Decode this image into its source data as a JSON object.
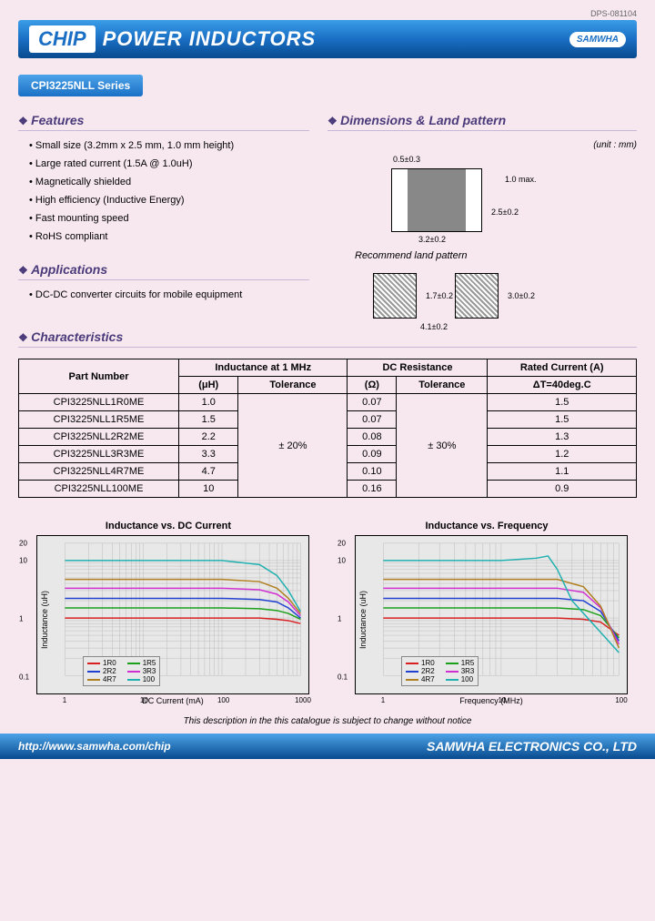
{
  "doc_id": "DPS-081104",
  "banner": {
    "chip": "CHIP",
    "title": "POWER INDUCTORS",
    "logo": "SAMWHA"
  },
  "series_badge": "CPI3225NLL Series",
  "features": {
    "title": "Features",
    "items": [
      "Small size (3.2mm x 2.5 mm, 1.0 mm height)",
      "Large rated current (1.5A @ 1.0uH)",
      "Magnetically shielded",
      "High efficiency (Inductive Energy)",
      "Fast mounting speed",
      "RoHS compliant"
    ]
  },
  "applications": {
    "title": "Applications",
    "items": [
      "DC-DC converter circuits for mobile equipment"
    ]
  },
  "dimensions": {
    "title": "Dimensions & Land pattern",
    "unit": "(unit : mm)",
    "dim_top": "0.5±0.3",
    "dim_height": "1.0 max.",
    "dim_width": "3.2±0.2",
    "dim_depth": "2.5±0.2",
    "land_title": "Recommend land pattern",
    "land_gap": "1.7±0.2",
    "land_h": "3.0±0.2",
    "land_w": "4.1±0.2"
  },
  "characteristics": {
    "title": "Characteristics",
    "headers": {
      "part": "Part Number",
      "ind": "Inductance at 1 MHz",
      "ind_uh": "(μH)",
      "ind_tol": "Tolerance",
      "dcr": "DC Resistance",
      "dcr_ohm": "(Ω)",
      "dcr_tol": "Tolerance",
      "rated": "Rated Current (A)",
      "rated_sub": "ΔT=40deg.C"
    },
    "ind_tol_val": "± 20%",
    "dcr_tol_val": "± 30%",
    "rows": [
      {
        "pn": "CPI3225NLL1R0ME",
        "uh": "1.0",
        "ohm": "0.07",
        "rated": "1.5"
      },
      {
        "pn": "CPI3225NLL1R5ME",
        "uh": "1.5",
        "ohm": "0.07",
        "rated": "1.5"
      },
      {
        "pn": "CPI3225NLL2R2ME",
        "uh": "2.2",
        "ohm": "0.08",
        "rated": "1.3"
      },
      {
        "pn": "CPI3225NLL3R3ME",
        "uh": "3.3",
        "ohm": "0.09",
        "rated": "1.2"
      },
      {
        "pn": "CPI3225NLL4R7ME",
        "uh": "4.7",
        "ohm": "0.10",
        "rated": "1.1"
      },
      {
        "pn": "CPI3225NLL100ME",
        "uh": "10",
        "ohm": "0.16",
        "rated": "0.9"
      }
    ]
  },
  "chart_data": [
    {
      "type": "line",
      "title": "Inductance vs. DC Current",
      "xlabel": "DC Current (mA)",
      "ylabel": "Inductance (uH)",
      "x_scale": "log",
      "y_scale": "log",
      "xlim": [
        1,
        1000
      ],
      "ylim": [
        0.1,
        20
      ],
      "x_ticks": [
        1,
        10,
        100,
        1000
      ],
      "y_ticks": [
        0.1,
        1,
        10,
        20
      ],
      "legend": [
        "1R0",
        "1R5",
        "2R2",
        "3R3",
        "4R7",
        "100"
      ],
      "colors": {
        "1R0": "#d92020",
        "1R5": "#1aa01a",
        "2R2": "#2040d0",
        "3R3": "#d030d0",
        "4R7": "#b08020",
        "100": "#20b0b0"
      },
      "series": [
        {
          "name": "1R0",
          "x": [
            1,
            100,
            300,
            500,
            700,
            1000
          ],
          "y": [
            1.0,
            1.0,
            1.0,
            0.95,
            0.9,
            0.8
          ]
        },
        {
          "name": "1R5",
          "x": [
            1,
            100,
            300,
            500,
            700,
            1000
          ],
          "y": [
            1.5,
            1.5,
            1.45,
            1.35,
            1.2,
            0.95
          ]
        },
        {
          "name": "2R2",
          "x": [
            1,
            100,
            300,
            500,
            700,
            1000
          ],
          "y": [
            2.2,
            2.2,
            2.1,
            1.9,
            1.5,
            1.0
          ]
        },
        {
          "name": "3R3",
          "x": [
            1,
            100,
            300,
            500,
            700,
            1000
          ],
          "y": [
            3.3,
            3.3,
            3.1,
            2.6,
            1.9,
            1.1
          ]
        },
        {
          "name": "4R7",
          "x": [
            1,
            100,
            300,
            500,
            700,
            1000
          ],
          "y": [
            4.7,
            4.7,
            4.3,
            3.3,
            2.2,
            1.2
          ]
        },
        {
          "name": "100",
          "x": [
            1,
            100,
            300,
            500,
            700,
            1000
          ],
          "y": [
            10,
            10,
            8.5,
            5.5,
            3.0,
            1.3
          ]
        }
      ]
    },
    {
      "type": "line",
      "title": "Inductance vs. Frequency",
      "xlabel": "Frequency (MHz)",
      "ylabel": "Inductance (uH)",
      "x_scale": "log",
      "y_scale": "log",
      "xlim": [
        1,
        100
      ],
      "ylim": [
        0.1,
        20
      ],
      "x_ticks": [
        1,
        10,
        100
      ],
      "y_ticks": [
        0.1,
        1,
        10,
        20
      ],
      "legend": [
        "1R0",
        "1R5",
        "2R2",
        "3R3",
        "4R7",
        "100"
      ],
      "colors": {
        "1R0": "#d92020",
        "1R5": "#1aa01a",
        "2R2": "#2040d0",
        "3R3": "#d030d0",
        "4R7": "#b08020",
        "100": "#20b0b0"
      },
      "series": [
        {
          "name": "1R0",
          "x": [
            1,
            10,
            30,
            50,
            70,
            100
          ],
          "y": [
            1.0,
            1.0,
            1.0,
            0.95,
            0.85,
            0.5
          ]
        },
        {
          "name": "1R5",
          "x": [
            1,
            10,
            30,
            50,
            70,
            100
          ],
          "y": [
            1.5,
            1.5,
            1.5,
            1.4,
            1.1,
            0.45
          ]
        },
        {
          "name": "2R2",
          "x": [
            1,
            10,
            30,
            50,
            70,
            100
          ],
          "y": [
            2.2,
            2.2,
            2.2,
            2.0,
            1.3,
            0.4
          ]
        },
        {
          "name": "3R3",
          "x": [
            1,
            10,
            30,
            50,
            70,
            100
          ],
          "y": [
            3.3,
            3.3,
            3.3,
            2.8,
            1.5,
            0.35
          ]
        },
        {
          "name": "4R7",
          "x": [
            1,
            10,
            30,
            50,
            70,
            100
          ],
          "y": [
            4.7,
            4.7,
            4.7,
            3.5,
            1.6,
            0.3
          ]
        },
        {
          "name": "100",
          "x": [
            1,
            10,
            20,
            25,
            30,
            40,
            100
          ],
          "y": [
            10,
            10,
            11,
            12,
            7,
            2,
            0.25
          ]
        }
      ]
    }
  ],
  "disclaimer": "This description in the this catalogue is subject to change without notice",
  "footer": {
    "url": "http://www.samwha.com/chip",
    "company": "SAMWHA ELECTRONICS CO., LTD"
  }
}
